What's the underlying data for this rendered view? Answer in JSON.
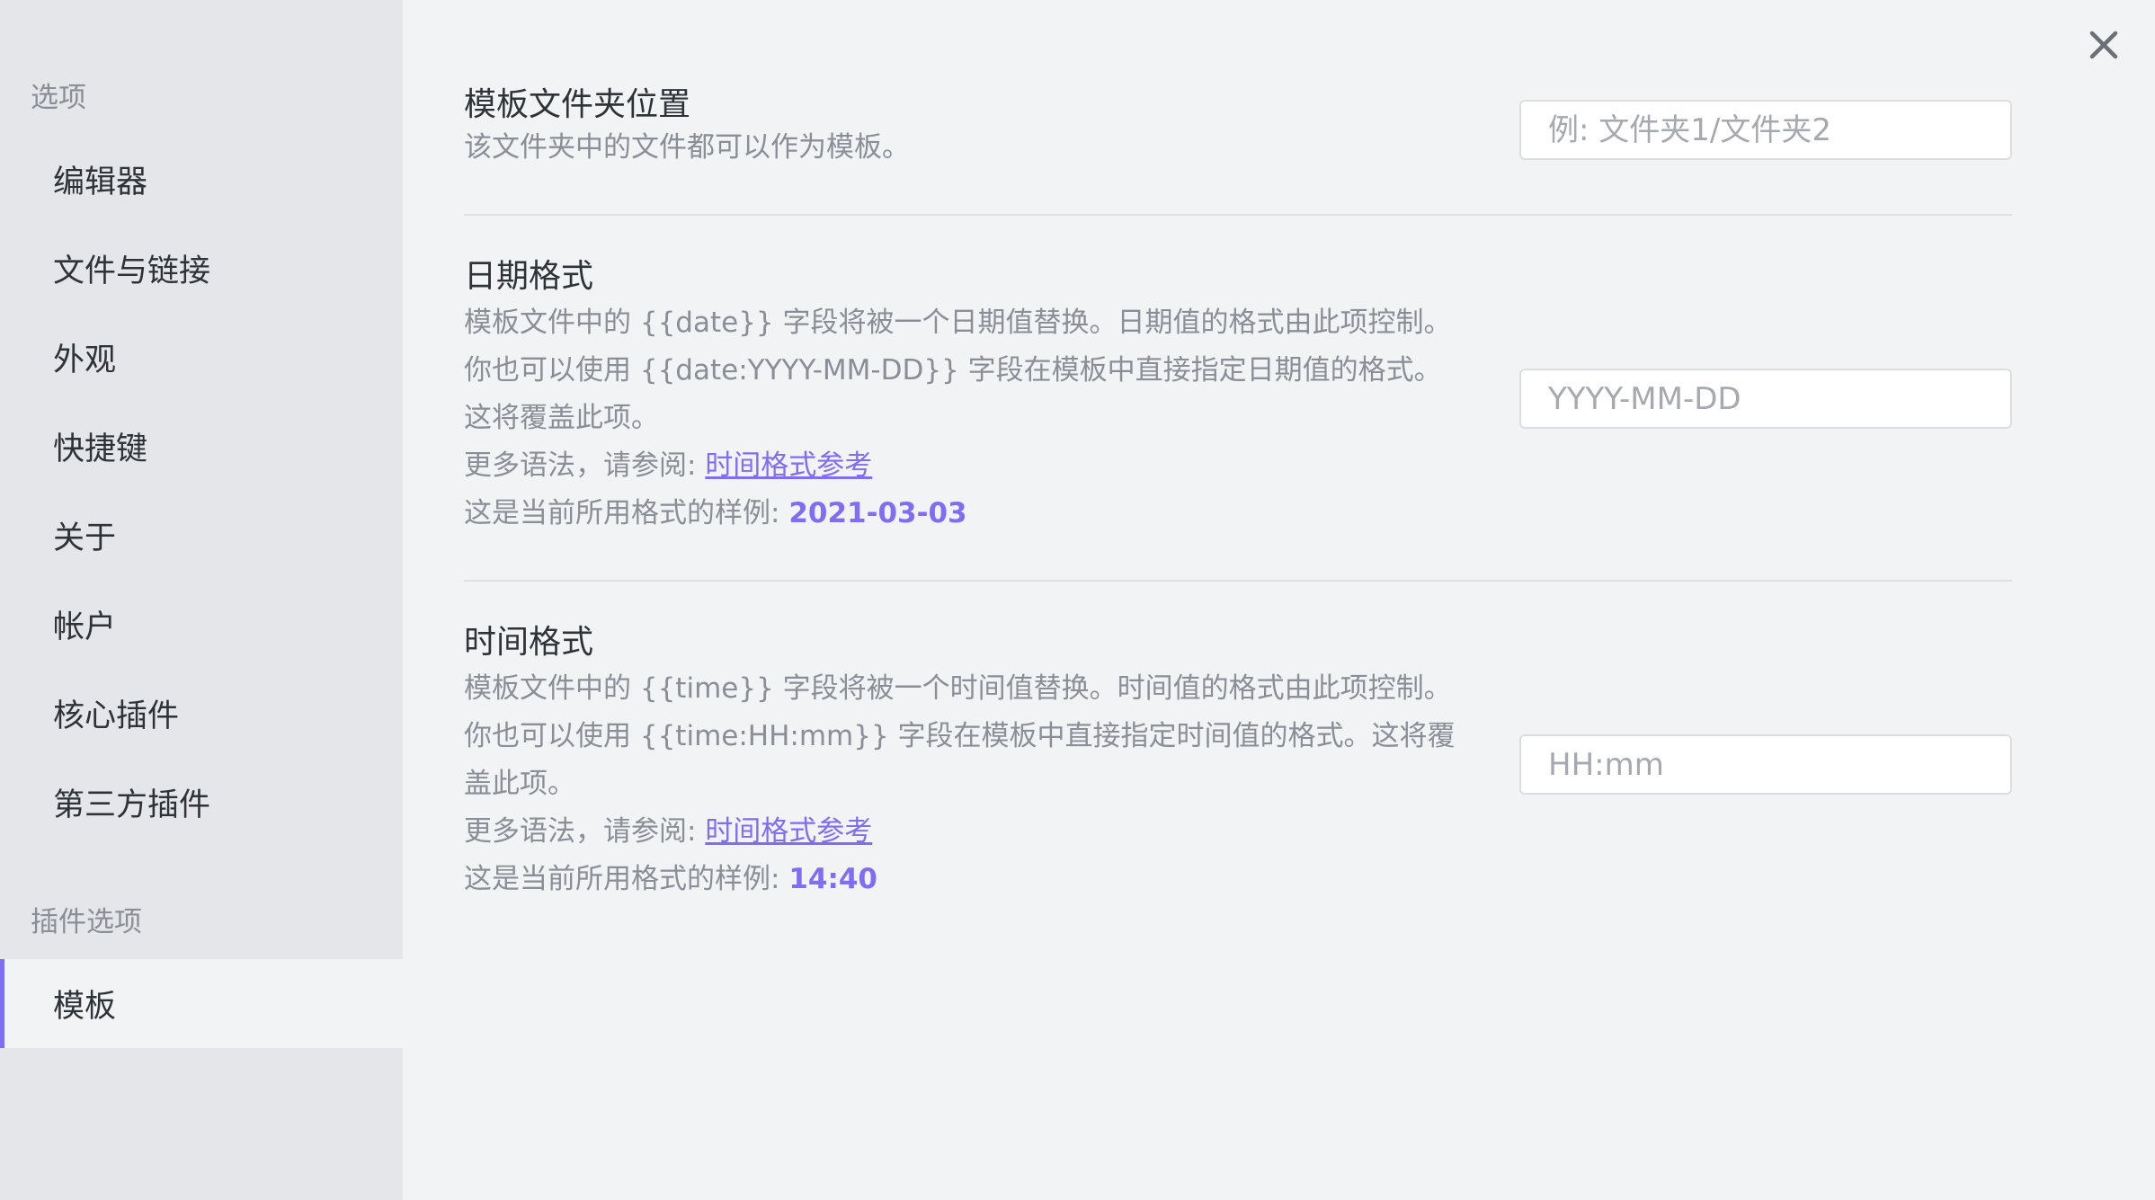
{
  "sidebar": {
    "options_heading": "选项",
    "items": [
      {
        "label": "编辑器"
      },
      {
        "label": "文件与链接"
      },
      {
        "label": "外观"
      },
      {
        "label": "快捷键"
      },
      {
        "label": "关于"
      },
      {
        "label": "帐户"
      },
      {
        "label": "核心插件"
      },
      {
        "label": "第三方插件"
      }
    ],
    "plugin_heading": "插件选项",
    "plugin_items": [
      {
        "label": "模板",
        "active": true
      }
    ]
  },
  "close_icon": "close-icon",
  "settings": {
    "folder": {
      "name": "模板文件夹位置",
      "desc": "该文件夹中的文件都可以作为模板。",
      "placeholder": "例: 文件夹1/文件夹2",
      "value": ""
    },
    "date": {
      "name": "日期格式",
      "desc_line1": "模板文件中的 {{date}} 字段将被一个日期值替换。日期值的格式由此项控制。",
      "desc_line2": "你也可以使用 {{date:YYYY-MM-DD}} 字段在模板中直接指定日期值的格式。这将覆盖此项。",
      "more_syntax": "更多语法，请参阅: ",
      "link_text": "时间格式参考",
      "sample_prefix": "这是当前所用格式的样例: ",
      "sample_value": "2021-03-03",
      "placeholder": "YYYY-MM-DD",
      "value": ""
    },
    "time": {
      "name": "时间格式",
      "desc_line1": "模板文件中的 {{time}} 字段将被一个时间值替换。时间值的格式由此项控制。",
      "desc_line2": "你也可以使用 {{time:HH:mm}} 字段在模板中直接指定时间值的格式。这将覆盖此项。",
      "more_syntax": "更多语法，请参阅: ",
      "link_text": "时间格式参考",
      "sample_prefix": "这是当前所用格式的样例: ",
      "sample_value": "14:40",
      "placeholder": "HH:mm",
      "value": ""
    }
  },
  "colors": {
    "accent": "#7f6df2",
    "sidebar_bg": "#e5e6e9",
    "content_bg": "#f2f3f5",
    "muted_text": "#8a8e97"
  }
}
